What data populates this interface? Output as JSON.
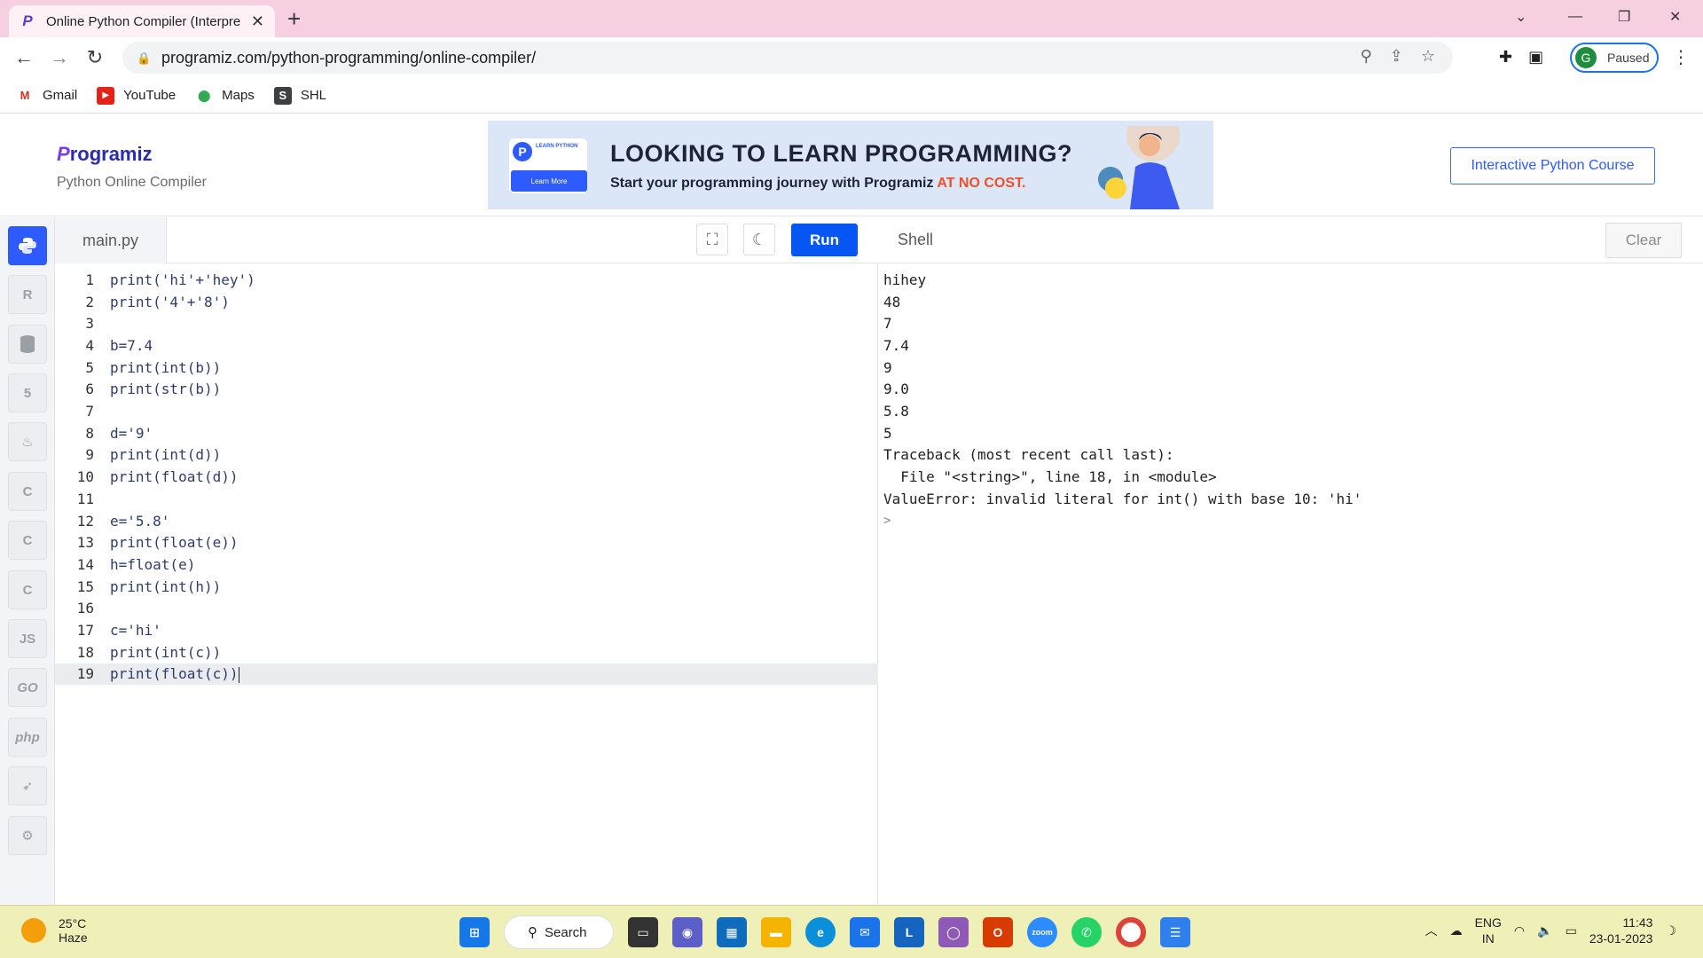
{
  "browser": {
    "tab_title": "Online Python Compiler (Interpre",
    "url": "programiz.com/python-programming/online-compiler/",
    "profile_initial": "G",
    "profile_status": "Paused",
    "bookmarks": [
      {
        "label": "Gmail",
        "icon": "gmail-icon"
      },
      {
        "label": "YouTube",
        "icon": "youtube-icon"
      },
      {
        "label": "Maps",
        "icon": "maps-icon"
      },
      {
        "label": "SHL",
        "icon": "shl-icon"
      }
    ]
  },
  "site": {
    "brand": "rogramiz",
    "brand_initial": "P",
    "subtitle": "Python Online Compiler",
    "banner": {
      "badge_text": "LEARN PYTHON",
      "learn_more": "Learn More",
      "headline": "LOOKING TO LEARN PROGRAMMING?",
      "tagline": "Start your programming journey with Programiz ",
      "tagline_accent": "AT NO COST."
    },
    "course_button": "Interactive Python Course"
  },
  "languages": [
    "python",
    "r",
    "sql",
    "html",
    "java",
    "c",
    "cpp",
    "csharp",
    "js",
    "go",
    "php",
    "swift",
    "rust"
  ],
  "lang_labels": {
    "js": "JS",
    "go": "GO",
    "php": "php"
  },
  "editor": {
    "file_name": "main.py",
    "run_label": "Run",
    "lines": [
      "print('hi'+'hey')",
      "print('4'+'8')",
      "",
      "b=7.4",
      "print(int(b))",
      "print(str(b))",
      "",
      "d='9'",
      "print(int(d))",
      "print(float(d))",
      "",
      "e='5.8'",
      "print(float(e))",
      "h=float(e)",
      "print(int(h))",
      "",
      "c='hi'",
      "print(int(c))",
      "print(float(c))"
    ],
    "current_line": 19
  },
  "shell": {
    "title": "Shell",
    "clear_label": "Clear",
    "output": [
      "hihey",
      "48",
      "7",
      "7.4",
      "9",
      "9.0",
      "5.8",
      "5",
      "Traceback (most recent call last):",
      "  File \"<string>\", line 18, in <module>",
      "ValueError: invalid literal for int() with base 10: 'hi'"
    ],
    "prompt": ">"
  },
  "taskbar": {
    "temperature": "25°C",
    "weather": "Haze",
    "search_label": "Search",
    "language_line1": "ENG",
    "language_line2": "IN",
    "time": "11:43",
    "date": "23-01-2023"
  }
}
